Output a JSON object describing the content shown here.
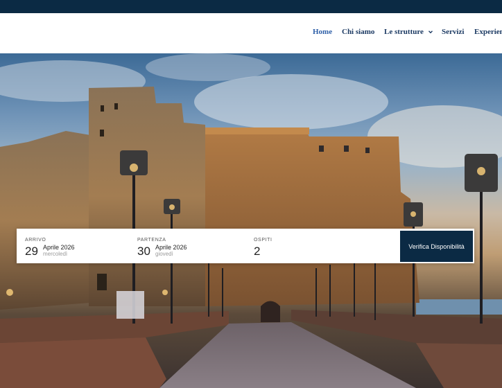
{
  "nav": {
    "items": [
      {
        "label": "Home",
        "active": true
      },
      {
        "label": "Chi siamo"
      },
      {
        "label": "Le strutture",
        "has_dropdown": true
      },
      {
        "label": "Servizi"
      },
      {
        "label": "Experien"
      }
    ]
  },
  "booking": {
    "arrival": {
      "label": "ARRIVO",
      "day": "29",
      "month": "Aprile 2026",
      "weekday": "mercoledì"
    },
    "departure": {
      "label": "PARTENZA",
      "day": "30",
      "month": "Aprile 2026",
      "weekday": "giovedì"
    },
    "guests": {
      "label": "OSPITI",
      "value": "2"
    },
    "cta_label": "Verifica Disponibilità"
  },
  "colors": {
    "brand_navy": "#0b2a44",
    "nav_text": "#1c3a63",
    "nav_active": "#2e5fa8"
  }
}
